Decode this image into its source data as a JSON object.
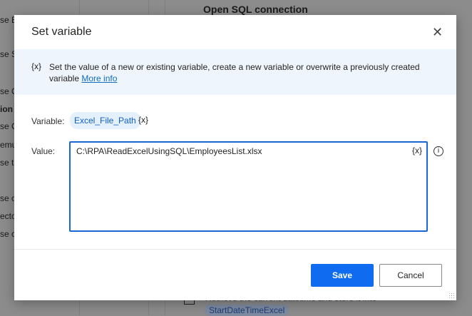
{
  "background": {
    "header": "Open SQL connection",
    "left_fragments": [
      "se E",
      "se S",
      "se C",
      "ion",
      "se C",
      "emu",
      "se t",
      "se c",
      "ecto",
      "se c"
    ],
    "bottom_line": "Retrieve the current datetime and store it into",
    "bottom_chip": "StartDateTimeExcel"
  },
  "dialog": {
    "title": "Set variable",
    "close_icon": "close-icon",
    "info": {
      "icon": "{x}",
      "text": "Set the value of a new or existing variable, create a new variable or overwrite a previously created variable",
      "link": "More info"
    },
    "variable": {
      "label": "Variable:",
      "name": "Excel_File_Path",
      "picker": "{x}"
    },
    "value": {
      "label": "Value:",
      "text": "C:\\RPA\\ReadExcelUsingSQL\\EmployeesList.xlsx",
      "picker": "{x}",
      "info": "i"
    },
    "buttons": {
      "save": "Save",
      "cancel": "Cancel"
    },
    "colors": {
      "accent": "#0f6cf0",
      "info_bg": "#eff5fd"
    }
  }
}
